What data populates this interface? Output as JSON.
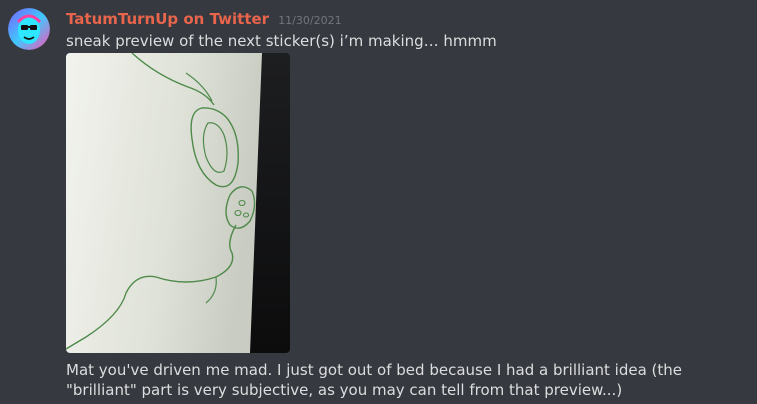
{
  "message": {
    "author": "TatumTurnUp on Twitter",
    "timestamp": "11/30/2021",
    "text": "sneak preview of the next sticker(s) i’m making… hmmm",
    "caption": "Mat you've driven me mad. I just got out of bed because I had a brilliant idea (the \"brilliant\" part is very subjective, as you may can tell from that preview...)"
  },
  "colors": {
    "background": "#36393f",
    "username": "#e8654c",
    "timestamp": "#72767d",
    "text": "#dcddde"
  },
  "icons": {
    "avatar": "avatar-icon"
  }
}
